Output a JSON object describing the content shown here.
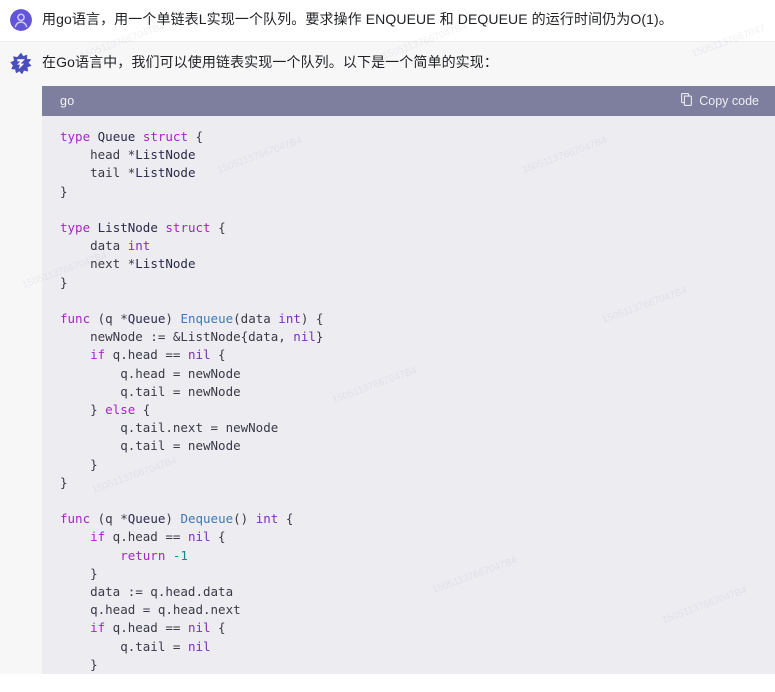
{
  "colors": {
    "page_background": "#ffffff",
    "assistant_background": "#f7f7f8",
    "code_header_background": "#7e7e9e",
    "code_background": "#ececf1",
    "user_avatar": "#6355d8",
    "accent_keyword": "#a626c4",
    "accent_function": "#4078b4",
    "accent_number": "#0b8a8a"
  },
  "conversation": {
    "user_message": {
      "avatar_icon": "user-person-icon",
      "text": "用go语言，用一个单链表L实现一个队列。要求操作 ENQUEUE 和 DEQUEUE 的运行时间仍为O(1)。"
    },
    "assistant_message": {
      "avatar_icon": "assistant-logo-icon",
      "text": "在Go语言中，我们可以使用链表实现一个队列。以下是一个简单的实现："
    }
  },
  "code_block": {
    "language_label": "go",
    "copy_icon": "copy-pages-icon",
    "copy_label": "Copy code",
    "lines": [
      [
        [
          "k",
          "type"
        ],
        [
          "p",
          " "
        ],
        [
          "n",
          "Queue"
        ],
        [
          "p",
          " "
        ],
        [
          "k",
          "struct"
        ],
        [
          "p",
          " {"
        ]
      ],
      [
        [
          "p",
          "    head *"
        ],
        [
          "n",
          "ListNode"
        ]
      ],
      [
        [
          "p",
          "    tail *"
        ],
        [
          "n",
          "ListNode"
        ]
      ],
      [
        [
          "p",
          "}"
        ]
      ],
      [
        [
          "p",
          ""
        ]
      ],
      [
        [
          "k",
          "type"
        ],
        [
          "p",
          " "
        ],
        [
          "n",
          "ListNode"
        ],
        [
          "p",
          " "
        ],
        [
          "k",
          "struct"
        ],
        [
          "p",
          " {"
        ]
      ],
      [
        [
          "p",
          "    data "
        ],
        [
          "t",
          "int"
        ]
      ],
      [
        [
          "p",
          "    next *"
        ],
        [
          "n",
          "ListNode"
        ]
      ],
      [
        [
          "p",
          "}"
        ]
      ],
      [
        [
          "p",
          ""
        ]
      ],
      [
        [
          "k",
          "func"
        ],
        [
          "p",
          " (q *"
        ],
        [
          "n",
          "Queue"
        ],
        [
          "p",
          ") "
        ],
        [
          "f",
          "Enqueue"
        ],
        [
          "p",
          "(data "
        ],
        [
          "t",
          "int"
        ],
        [
          "p",
          ") {"
        ]
      ],
      [
        [
          "p",
          "    newNode := &ListNode{data, "
        ],
        [
          "t",
          "nil"
        ],
        [
          "p",
          "}"
        ]
      ],
      [
        [
          "k",
          "    if"
        ],
        [
          "p",
          " q.head == "
        ],
        [
          "t",
          "nil"
        ],
        [
          "p",
          " {"
        ]
      ],
      [
        [
          "p",
          "        q.head = newNode"
        ]
      ],
      [
        [
          "p",
          "        q.tail = newNode"
        ]
      ],
      [
        [
          "p",
          "    } "
        ],
        [
          "k",
          "else"
        ],
        [
          "p",
          " {"
        ]
      ],
      [
        [
          "p",
          "        q.tail.next = newNode"
        ]
      ],
      [
        [
          "p",
          "        q.tail = newNode"
        ]
      ],
      [
        [
          "p",
          "    }"
        ]
      ],
      [
        [
          "p",
          "}"
        ]
      ],
      [
        [
          "p",
          ""
        ]
      ],
      [
        [
          "k",
          "func"
        ],
        [
          "p",
          " (q *"
        ],
        [
          "n",
          "Queue"
        ],
        [
          "p",
          ") "
        ],
        [
          "f",
          "Dequeue"
        ],
        [
          "p",
          "() "
        ],
        [
          "t",
          "int"
        ],
        [
          "p",
          " {"
        ]
      ],
      [
        [
          "k",
          "    if"
        ],
        [
          "p",
          " q.head == "
        ],
        [
          "t",
          "nil"
        ],
        [
          "p",
          " {"
        ]
      ],
      [
        [
          "k",
          "        return"
        ],
        [
          "p",
          " "
        ],
        [
          "num",
          "-1"
        ]
      ],
      [
        [
          "p",
          "    }"
        ]
      ],
      [
        [
          "p",
          "    data := q.head.data"
        ]
      ],
      [
        [
          "p",
          "    q.head = q.head.next"
        ]
      ],
      [
        [
          "k",
          "    if"
        ],
        [
          "p",
          " q.head == "
        ],
        [
          "t",
          "nil"
        ],
        [
          "p",
          " {"
        ]
      ],
      [
        [
          "p",
          "        q.tail = "
        ],
        [
          "t",
          "nil"
        ]
      ],
      [
        [
          "p",
          "    }"
        ]
      ]
    ]
  }
}
